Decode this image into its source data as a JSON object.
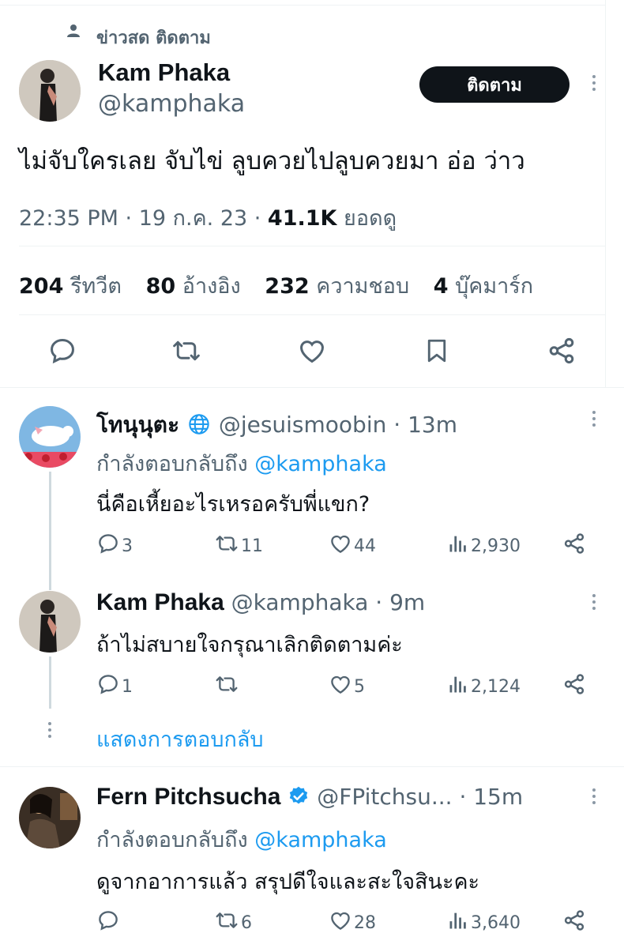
{
  "social_context": {
    "label": "ข่าวสด ติดตาม"
  },
  "main_tweet": {
    "author_name": "Kam Phaka",
    "author_handle": "@kamphaka",
    "follow_label": "ติดตาม",
    "text": "ไม่จับใครเลย จับไข่ ลูบควยไปลูบควยมา อ่อ ว่าว",
    "time": "22:35 PM · 19 ก.ค. 23 · ",
    "views_count": "41.1K",
    "views_label": " ยอดดู",
    "stats": [
      {
        "count": "204",
        "label": "รีทวีต"
      },
      {
        "count": "80",
        "label": "อ้างอิง"
      },
      {
        "count": "232",
        "label": "ความชอบ"
      },
      {
        "count": "4",
        "label": "บุ๊คมาร์ก"
      }
    ]
  },
  "replies": [
    {
      "name": "โทนุนุตะ",
      "handle": "@jesuismoobin",
      "time": "· 13m",
      "replying_prefix": "กำลังตอบกลับถึง ",
      "replying_handle": "@kamphaka",
      "text": "นี่คือเหี้ยอะไรเหรอครับพี่แขก?",
      "replies": "3",
      "retweets": "11",
      "likes": "44",
      "views": "2,930"
    },
    {
      "name": "Kam Phaka",
      "handle": "@kamphaka",
      "time": "· 9m",
      "text": "ถ้าไม่สบายใจกรุณาเลิกติดตามค่ะ",
      "replies": "1",
      "retweets": "",
      "likes": "5",
      "views": "2,124"
    },
    {
      "name": "Fern Pitchsucha",
      "handle": "@FPitchsu...",
      "time": "· 15m",
      "replying_prefix": "กำลังตอบกลับถึง ",
      "replying_handle": "@kamphaka",
      "text": "ดูจากอาการแล้ว สรุปดีใจและสะใจสินะคะ",
      "replies": "",
      "retweets": "6",
      "likes": "28",
      "views": "3,640"
    }
  ],
  "show_replies": "แสดงการตอบกลับ",
  "colors": {
    "accent": "#1d9bf0",
    "text": "#0f1419",
    "muted": "#536471",
    "follow_bg": "#0f1419",
    "verified": "#1d9bf0"
  }
}
